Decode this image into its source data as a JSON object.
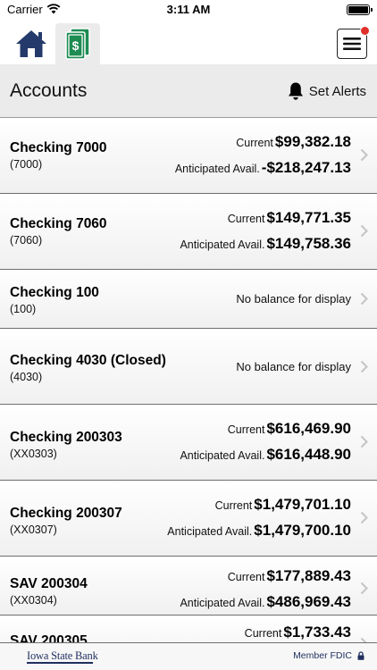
{
  "status_bar": {
    "carrier": "Carrier",
    "time": "3:11 AM"
  },
  "nav": {
    "home_icon": "home-icon",
    "accounts_icon": "dollar-bills-icon",
    "menu_icon": "hamburger-menu-icon",
    "notification_dot_color": "#e0302a"
  },
  "header": {
    "title": "Accounts",
    "set_alerts_label": "Set Alerts",
    "alert_icon": "bell-icon"
  },
  "accounts": [
    {
      "name": "Checking 7000",
      "number": "(7000)",
      "current_label": "Current",
      "current": "$99,382.18",
      "anticipated_label": "Anticipated Avail.",
      "anticipated": "-$218,247.13"
    },
    {
      "name": "Checking 7060",
      "number": "(7060)",
      "current_label": "Current",
      "current": "$149,771.35",
      "anticipated_label": "Anticipated Avail.",
      "anticipated": "$149,758.36"
    },
    {
      "name": "Checking 100",
      "number": "(100)",
      "no_balance": "No balance for display"
    },
    {
      "name": "Checking 4030 (Closed)",
      "number": "(4030)",
      "no_balance": "No balance for display"
    },
    {
      "name": "Checking 200303",
      "number": "(XX0303)",
      "current_label": "Current",
      "current": "$616,469.90",
      "anticipated_label": "Anticipated Avail.",
      "anticipated": "$616,448.90"
    },
    {
      "name": "Checking 200307",
      "number": "(XX0307)",
      "current_label": "Current",
      "current": "$1,479,701.10",
      "anticipated_label": "Anticipated Avail.",
      "anticipated": "$1,479,700.10"
    },
    {
      "name": "SAV 200304",
      "number": "(XX0304)",
      "current_label": "Current",
      "current": "$177,889.43",
      "anticipated_label": "Anticipated Avail.",
      "anticipated": "$486,969.43"
    },
    {
      "name": "SAV 200305",
      "number": "",
      "current_label": "Current",
      "current": "$1,733.43"
    }
  ],
  "footer": {
    "logo_text": "Iowa State Bank",
    "fdic_text": "Member FDIC",
    "lock_icon": "lock-icon",
    "brand_color": "#1f2f5f"
  }
}
